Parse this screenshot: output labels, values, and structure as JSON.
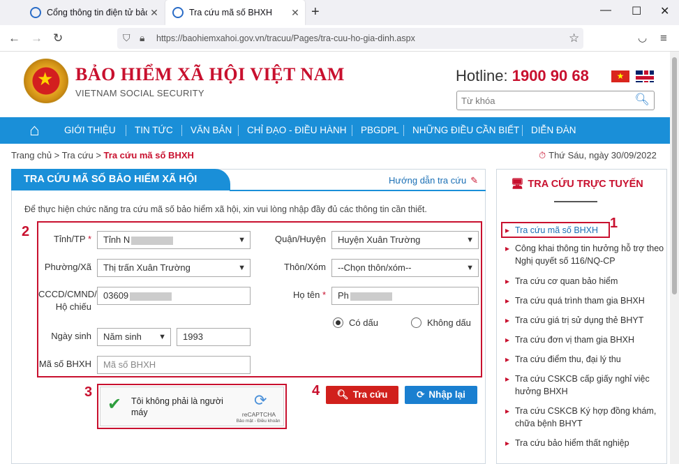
{
  "browser": {
    "tabs": [
      {
        "label": "Cổng thông tin điện tử bảo hiểm"
      },
      {
        "label": "Tra cứu mã số BHXH"
      }
    ],
    "url": "https://baohiemxahoi.gov.vn/tracuu/Pages/tra-cuu-ho-gia-dinh.aspx"
  },
  "header": {
    "brand": "BẢO HIỂM XÃ HỘI VIỆT NAM",
    "brand_sub": "VIETNAM SOCIAL SECURITY",
    "hotline_label": "Hotline:",
    "hotline_number": "1900 90 68",
    "search_placeholder": "Từ khóa"
  },
  "menu": [
    "GIỚI THIỆU",
    "TIN TỨC",
    "VĂN BẢN",
    "CHỈ ĐẠO - ĐIỀU HÀNH",
    "PBGDPL",
    "NHỮNG ĐIỀU CẦN BIẾT",
    "DIỄN ĐÀN"
  ],
  "breadcrumb": {
    "home": "Trang chủ >",
    "lookup": "Tra cứu >",
    "current": "Tra cứu mã số BHXH"
  },
  "date": "Thứ Sáu, ngày 30/09/2022",
  "panel": {
    "title": "TRA CỨU MÃ SỐ BẢO HIỂM XÃ HỘI",
    "guide": "Hướng dẫn tra cứu",
    "intro": "Để thực hiện chức năng tra cứu mã số bảo hiểm xã hội, xin vui lòng nhập đầy đủ các thông tin cần thiết."
  },
  "form": {
    "province_label": "Tỉnh/TP",
    "province_value": "Tỉnh N",
    "district_label": "Quận/Huyện",
    "district_value": "Huyện Xuân Trường",
    "ward_label": "Phường/Xã",
    "ward_value": "Thị trấn Xuân Trường",
    "village_label": "Thôn/Xóm",
    "village_value": "--Chọn thôn/xóm--",
    "id_label_1": "CCCD/CMND/",
    "id_label_2": "Hộ chiếu",
    "id_value": "03609",
    "name_label": "Họ tên",
    "name_value": "Ph",
    "accent_on": "Có dấu",
    "accent_off": "Không dấu",
    "dob_label": "Ngày sinh",
    "dob_type": "Năm sinh",
    "dob_year": "1993",
    "ssn_label": "Mã số BHXH",
    "ssn_placeholder": "Mã số BHXH",
    "required_mark": "*"
  },
  "captcha": {
    "text": "Tôi không phải là người máy",
    "brand": "reCAPTCHA",
    "terms": "Bảo mật - Điều khoản"
  },
  "buttons": {
    "search": "Tra cứu",
    "reset": "Nhập lại"
  },
  "steps": [
    "1",
    "2",
    "3",
    "4"
  ],
  "sidebar": {
    "title": "TRA CỨU TRỰC TUYẾN",
    "items": [
      "Tra cứu mã số BHXH",
      "Công khai thông tin hưởng hỗ trợ theo Nghị quyết số 116/NQ-CP",
      "Tra cứu cơ quan bảo hiểm",
      "Tra cứu quá trình tham gia BHXH",
      "Tra cứu giá trị sử dụng thẻ BHYT",
      "Tra cứu đơn vị tham gia BHXH",
      "Tra cứu điểm thu, đại lý thu",
      "Tra cứu CSKCB cấp giấy nghỉ việc hưởng BHXH",
      "Tra cứu CSKCB Ký hợp đồng khám, chữa bệnh BHYT",
      "Tra cứu bảo hiểm thất nghiệp"
    ]
  },
  "colors": {
    "brand_red": "#c8102e",
    "menu_blue": "#1a8fd8"
  }
}
